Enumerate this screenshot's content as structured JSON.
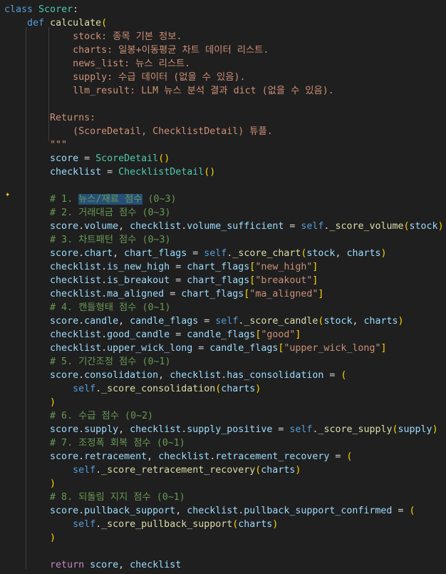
{
  "lines": [
    "class Scorer:",
    "    def calculate(",
    "            stock: 종목 기본 정보.",
    "            charts: 일봉+이동평균 차트 데이터 리스트.",
    "            news_list: 뉴스 리스트.",
    "            supply: 수급 데이터 (없을 수 있음).",
    "            llm_result: LLM 뉴스 분석 결과 dict (없을 수 있음).",
    "",
    "        Returns:",
    "            (ScoreDetail, ChecklistDetail) 튜플.",
    "        \"\"\"",
    "        score = ScoreDetail()",
    "        checklist = ChecklistDetail()",
    "",
    "        # 1. 뉴스/재료 점수 (0~3)",
    "        # 2. 거래대금 점수 (0~3)",
    "        score.volume, checklist.volume_sufficient = self._score_volume(stock)",
    "        # 3. 차트패턴 점수 (0~3)",
    "        score.chart, chart_flags = self._score_chart(stock, charts)",
    "        checklist.is_new_high = chart_flags[\"new_high\"]",
    "        checklist.is_breakout = chart_flags[\"breakout\"]",
    "        checklist.ma_aligned = chart_flags[\"ma_aligned\"]",
    "        # 4. 캔들형태 점수 (0~1)",
    "        score.candle, candle_flags = self._score_candle(stock, charts)",
    "        checklist.good_candle = candle_flags[\"good\"]",
    "        checklist.upper_wick_long = candle_flags[\"upper_wick_long\"]",
    "        # 5. 기간조정 점수 (0~1)",
    "        score.consolidation, checklist.has_consolidation = (",
    "            self._score_consolidation(charts)",
    "        )",
    "        # 6. 수급 점수 (0~2)",
    "        score.supply, checklist.supply_positive = self._score_supply(supply)",
    "        # 7. 조정폭 회복 점수 (0~1)",
    "        score.retracement, checklist.retracement_recovery = (",
    "            self._score_retracement_recovery(charts)",
    "        )",
    "        # 8. 되돌림 지지 점수 (0~1)",
    "        score.pullback_support, checklist.pullback_support_confirmed = (",
    "            self._score_pullback_support(charts)",
    "        )",
    "",
    "        return score, checklist"
  ],
  "highlight": {
    "line_index": 14,
    "text": "뉴스/재료 점수"
  },
  "gutter_icon": "sparkle-lightbulb-icon",
  "colors": {
    "background": "#1f1f1f",
    "keyword": "#569cd6",
    "control": "#c586c0",
    "class": "#4ec9b0",
    "function": "#dcdcaa",
    "variable": "#9cdcfe",
    "string": "#ce9178",
    "comment": "#6a9955",
    "selection": "#264f78"
  }
}
